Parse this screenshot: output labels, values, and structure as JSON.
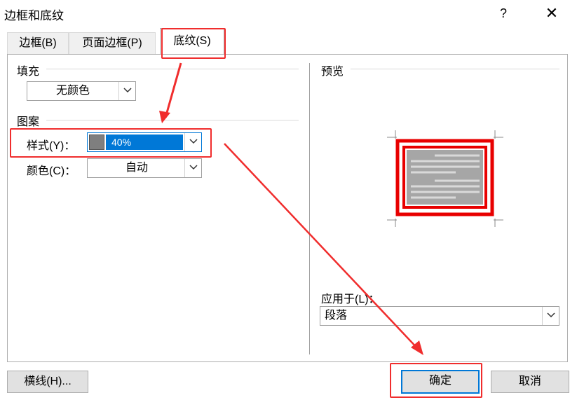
{
  "window": {
    "title": "边框和底纹",
    "help_label": "?",
    "close_label": "✕"
  },
  "tabs": [
    {
      "label": "边框(B)",
      "active": false
    },
    {
      "label": "页面边框(P)",
      "active": false
    },
    {
      "label": "底纹(S)",
      "active": true
    }
  ],
  "fill": {
    "group_label": "填充",
    "color_value": "无颜色"
  },
  "pattern": {
    "group_label": "图案",
    "style_label": "样式(Y)：",
    "style_value": "40%",
    "style_swatch": "#7f7f7f",
    "color_label": "颜色(C)：",
    "color_value": "自动"
  },
  "preview": {
    "group_label": "预览"
  },
  "apply_to": {
    "label": "应用于(L)：",
    "value": "段落"
  },
  "buttons": {
    "horizontal_line": "横线(H)...",
    "ok": "确定",
    "cancel": "取消"
  },
  "colors": {
    "accent": "#0078d7",
    "annotation": "#f02d2d",
    "shading": "#a6a6a6",
    "preview_border": "#e80000"
  }
}
